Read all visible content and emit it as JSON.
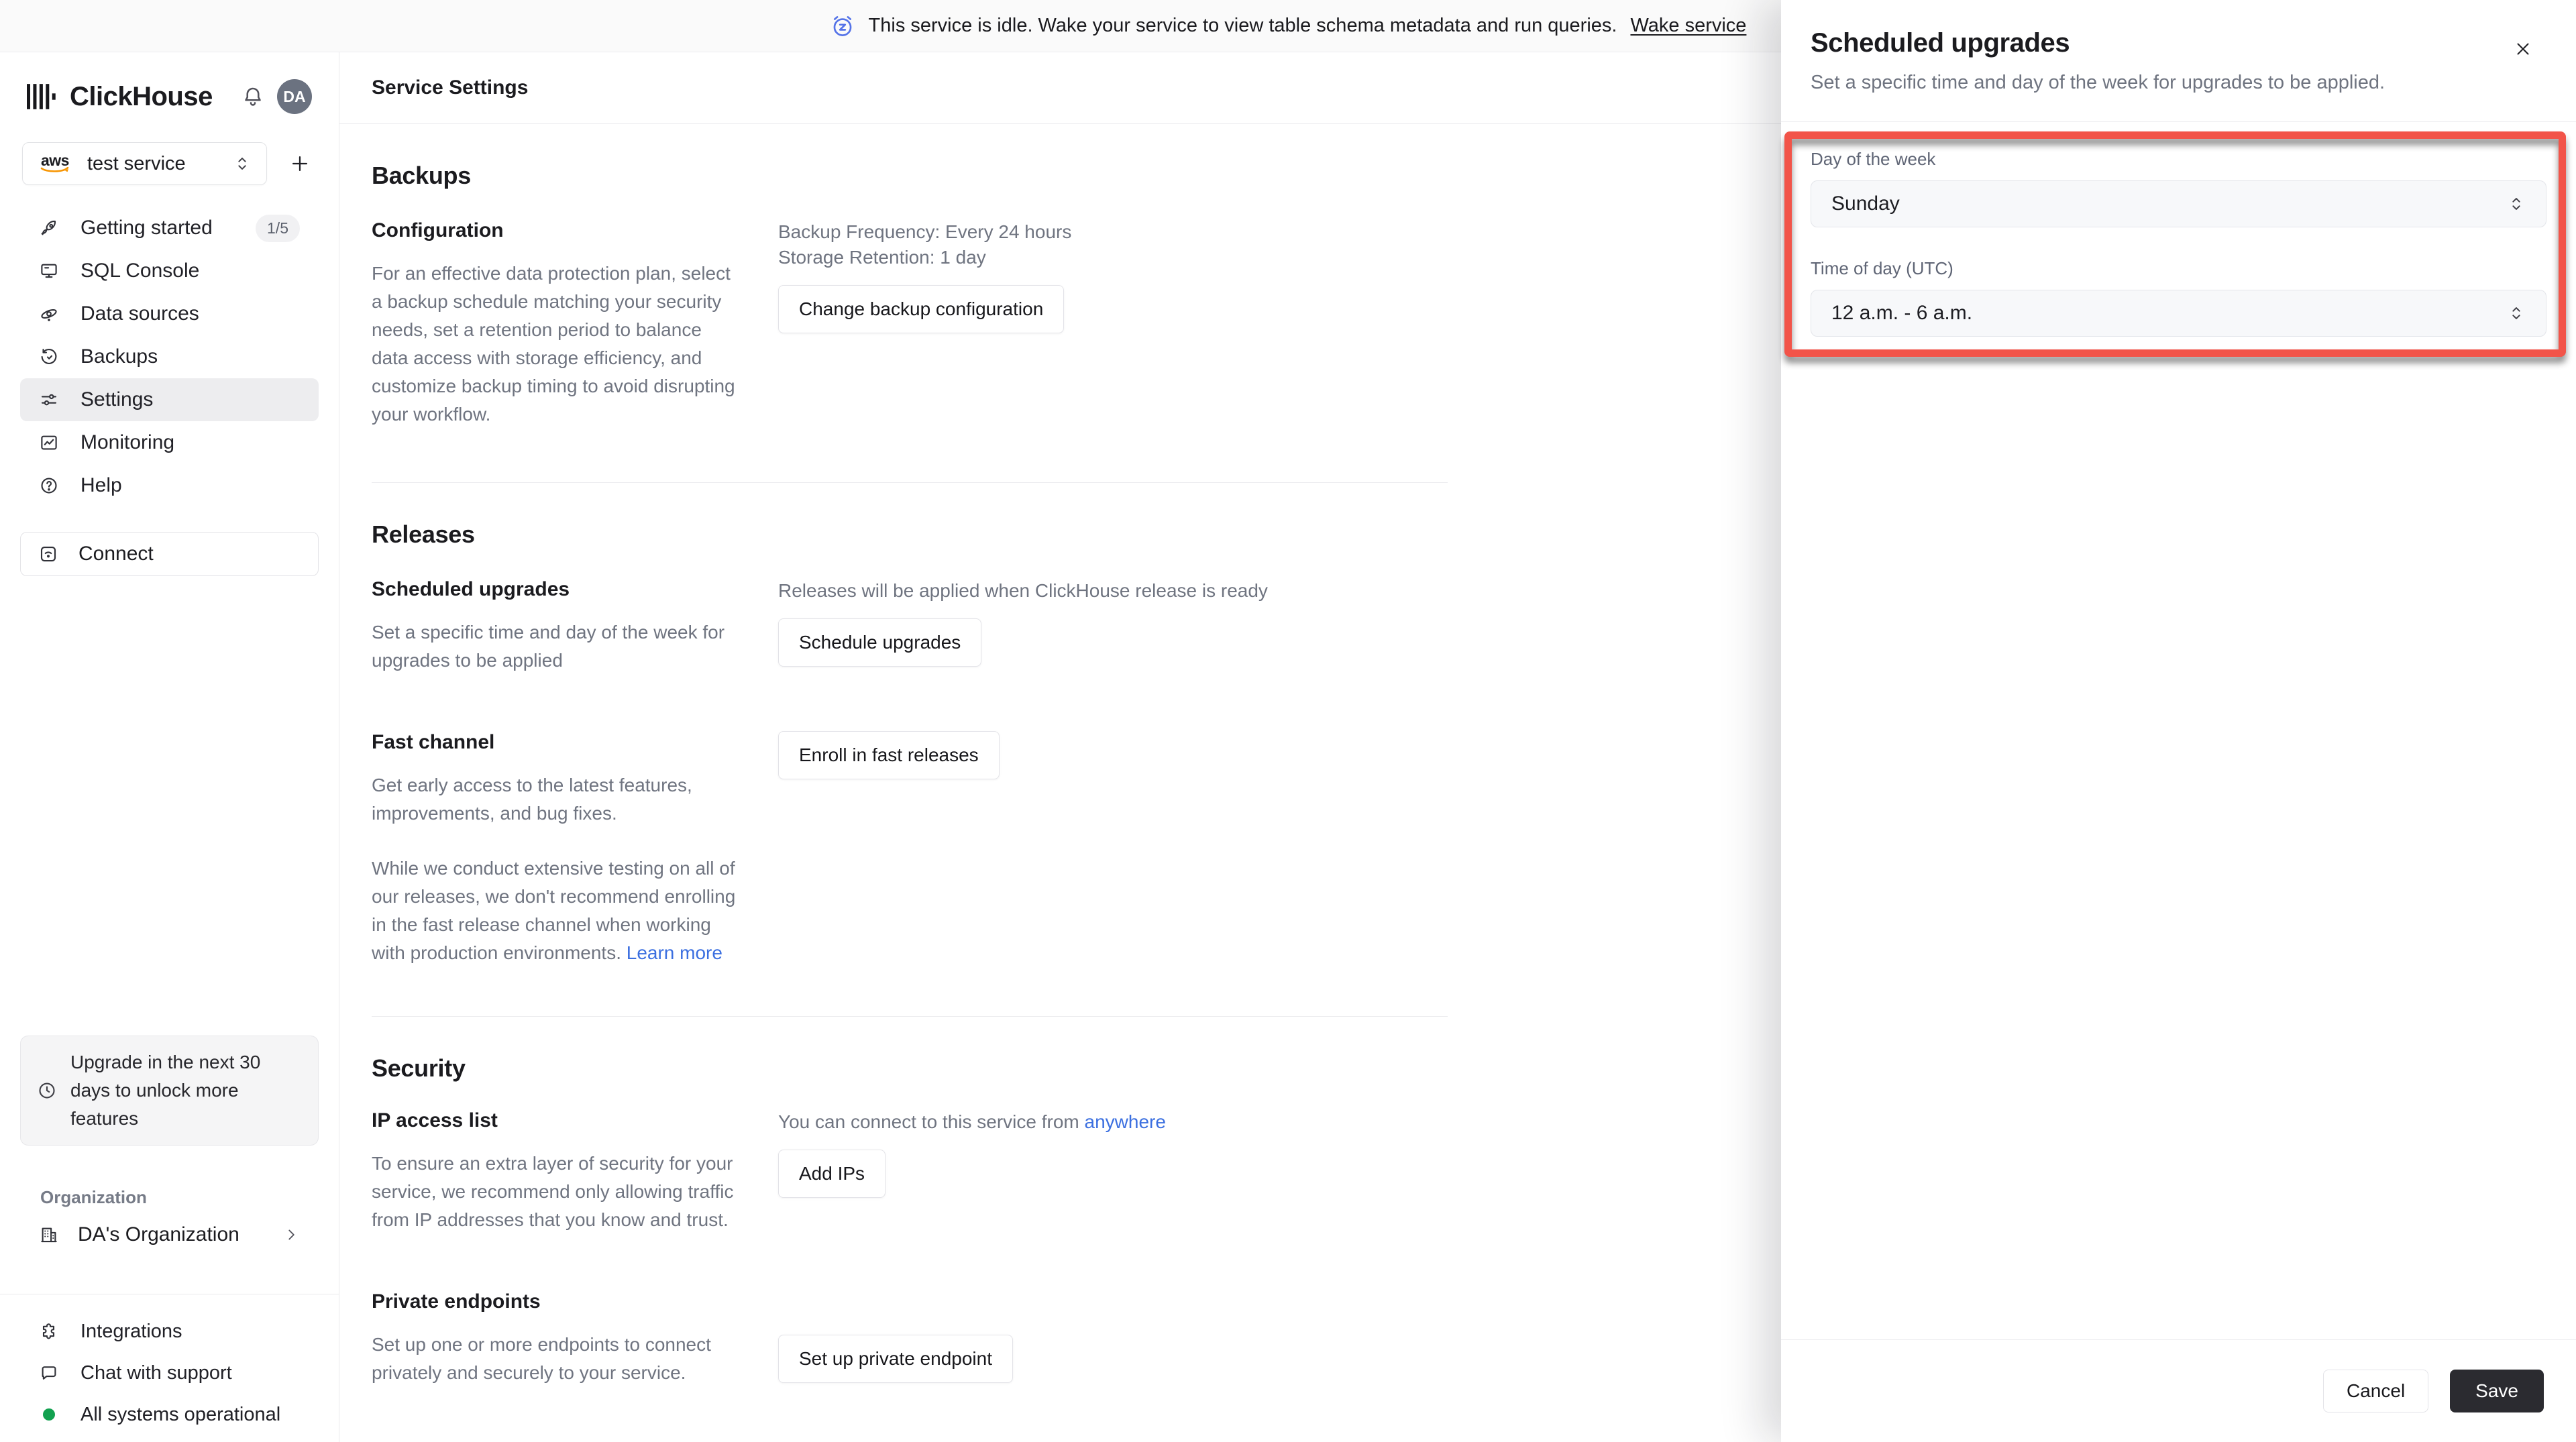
{
  "banner": {
    "message": "This service is idle. Wake your service to view table schema metadata and run queries.",
    "action": "Wake service",
    "icon": "alarm-snooze-icon",
    "icon_color": "#5573e8"
  },
  "sidebar": {
    "brand": "ClickHouse",
    "avatar_initials": "DA",
    "service": {
      "provider": "aws",
      "name": "test service"
    },
    "nav": [
      {
        "label": "Getting started",
        "icon": "rocket-icon",
        "badge": "1/5"
      },
      {
        "label": "SQL Console",
        "icon": "console-icon"
      },
      {
        "label": "Data sources",
        "icon": "data-sources-icon"
      },
      {
        "label": "Backups",
        "icon": "backups-icon"
      },
      {
        "label": "Settings",
        "icon": "settings-icon",
        "active": true
      },
      {
        "label": "Monitoring",
        "icon": "monitoring-icon"
      },
      {
        "label": "Help",
        "icon": "help-icon"
      }
    ],
    "connect_label": "Connect",
    "upgrade_notice": "Upgrade in the next 30 days to unlock more features",
    "organization": {
      "section_label": "Organization",
      "name": "DA's Organization"
    },
    "links": [
      {
        "label": "Integrations",
        "icon": "puzzle-icon"
      },
      {
        "label": "Chat with support",
        "icon": "chat-icon"
      },
      {
        "label": "All systems operational",
        "icon": "status-dot",
        "status_color": "#12a150"
      }
    ]
  },
  "main": {
    "title": "Service Settings",
    "backups": {
      "heading": "Backups",
      "configuration": {
        "heading": "Configuration",
        "description": "For an effective data protection plan, select a backup schedule matching your security needs, set a retention period to balance data access with storage efficiency, and customize backup timing to avoid disrupting your workflow.",
        "frequency": "Backup Frequency: Every 24 hours",
        "retention": "Storage Retention: 1 day",
        "button": "Change backup configuration"
      }
    },
    "releases": {
      "heading": "Releases",
      "scheduled": {
        "heading": "Scheduled upgrades",
        "description": "Set a specific time and day of the week for upgrades to be applied",
        "note": "Releases will be applied when ClickHouse release is ready",
        "button": "Schedule upgrades"
      },
      "fast": {
        "heading": "Fast channel",
        "description": "Get early access to the latest features, improvements, and bug fixes.",
        "warning": "While we conduct extensive testing on all of our releases, we don't recommend enrolling in the fast release channel when working with production environments.",
        "link": "Learn more",
        "button": "Enroll in fast releases"
      }
    },
    "security": {
      "heading": "Security",
      "ip_access": {
        "heading": "IP access list",
        "note_prefix": "You can connect to this service from ",
        "note_link": "anywhere",
        "description": "To ensure an extra layer of security for your service, we recommend only allowing traffic from IP addresses that you know and trust.",
        "button": "Add IPs"
      },
      "private_endpoints": {
        "heading": "Private endpoints",
        "description": "Set up one or more endpoints to connect privately and securely to your service.",
        "button": "Set up private endpoint"
      }
    }
  },
  "panel": {
    "title": "Scheduled upgrades",
    "description": "Set a specific time and day of the week for upgrades to be applied.",
    "day": {
      "label": "Day of the week",
      "value": "Sunday"
    },
    "time": {
      "label": "Time of day (UTC)",
      "value": "12 a.m. - 6 a.m."
    },
    "cancel": "Cancel",
    "save": "Save"
  },
  "colors": {
    "annotation_red": "#f25449",
    "link_blue": "#3b6fe0",
    "save_button": "#2b2b30",
    "status_green": "#12a150",
    "aws_orange": "#f79400"
  }
}
